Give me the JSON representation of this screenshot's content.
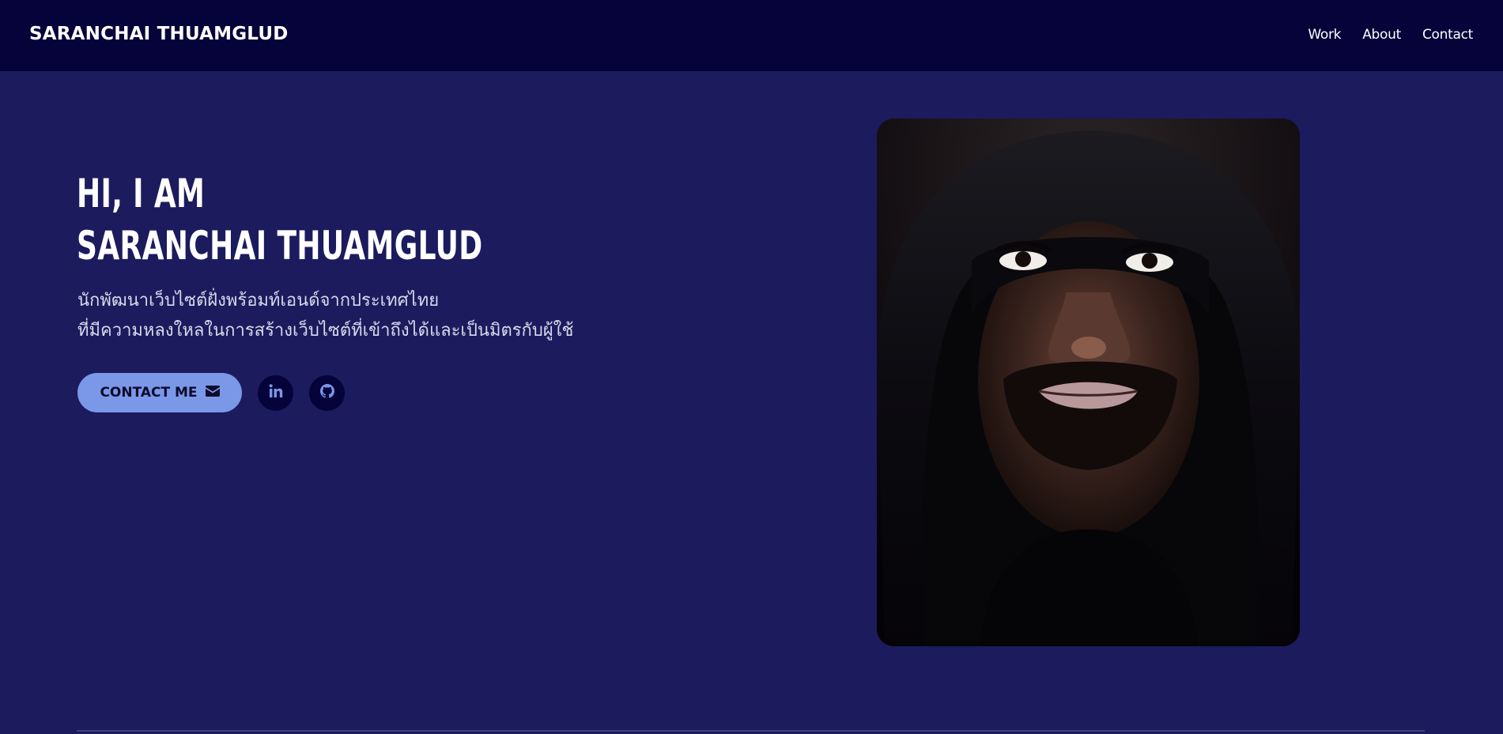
{
  "header": {
    "brand": "SARANCHAI THUAMGLUD",
    "nav": [
      "Work",
      "About",
      "Contact"
    ]
  },
  "hero": {
    "greeting": "HI, I AM",
    "name": "SARANCHAI THUAMGLUD",
    "description_line1": "นักพัฒนาเว็บไซต์ฝั่งพร้อมท์เอนด์จากประเทศไทย",
    "description_line2": "ที่มีความหลงใหลในการสร้างเว็บไซต์ที่เข้าถึงได้และเป็นมิตรกับผู้ใช้",
    "contact_button": "CONTACT ME",
    "contact_icon": "envelope-icon",
    "social_icons": [
      "linkedin-icon",
      "github-icon"
    ],
    "portrait_alt": "portrait-photo"
  },
  "colors": {
    "header_bg": "#05033a",
    "page_bg": "#1b1b5e",
    "accent_button": "#7b97e8",
    "social_bg": "#05033a",
    "social_icon": "#7b97e8"
  }
}
